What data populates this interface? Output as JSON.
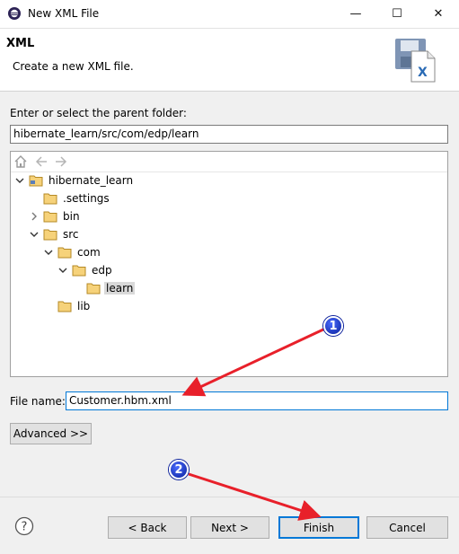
{
  "window": {
    "title": "New XML File",
    "controls": [
      "minimize-icon",
      "maximize-icon",
      "close-icon"
    ]
  },
  "header": {
    "title": "XML",
    "description": "Create a new XML file."
  },
  "folder": {
    "label": "Enter or select the parent folder:",
    "value": "hibernate_learn/src/com/edp/learn"
  },
  "tree": {
    "toolbar": [
      "home-icon",
      "back-arrow-icon",
      "forward-arrow-icon"
    ],
    "items": [
      {
        "label": "hibernate_learn",
        "expanded": true,
        "icon": "project-folder-icon"
      },
      {
        "label": ".settings",
        "icon": "folder-icon"
      },
      {
        "label": "bin",
        "expanded": false,
        "icon": "folder-icon"
      },
      {
        "label": "src",
        "expanded": true,
        "icon": "folder-icon"
      },
      {
        "label": "com",
        "expanded": true,
        "icon": "folder-icon"
      },
      {
        "label": "edp",
        "expanded": true,
        "icon": "folder-icon"
      },
      {
        "label": "learn",
        "selected": true,
        "icon": "folder-icon"
      },
      {
        "label": "lib",
        "icon": "folder-icon"
      }
    ]
  },
  "filename": {
    "label": "File name:",
    "value": "Customer.hbm.xml"
  },
  "buttons": {
    "advanced": "Advanced >>",
    "back": "< Back",
    "next": "Next >",
    "finish": "Finish",
    "cancel": "Cancel",
    "help": "?"
  },
  "annotations": {
    "badge1": "1",
    "badge2": "2",
    "arrow_color": "#e8202a"
  },
  "colors": {
    "focus_border": "#0078d7",
    "selection": "#d9d9d9"
  }
}
